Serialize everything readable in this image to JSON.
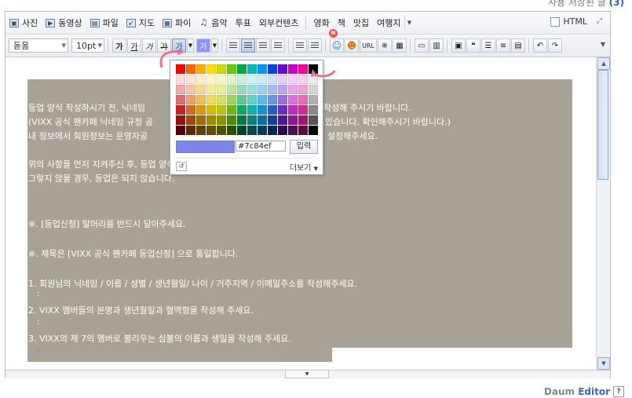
{
  "top": {
    "label": "사용 저장된 글",
    "count": "(3)"
  },
  "toolbar1": {
    "items": [
      {
        "label": "사진",
        "icon": "photo-icon"
      },
      {
        "label": "동영상",
        "icon": "video-icon"
      },
      {
        "label": "파일",
        "icon": "file-icon"
      },
      {
        "label": "지도",
        "icon": "map-icon"
      },
      {
        "label": "파이",
        "icon": "chart-icon"
      },
      {
        "label": "음악",
        "icon": "music-icon"
      },
      {
        "label": "투표",
        "icon": ""
      },
      {
        "label": "외부컨텐츠",
        "icon": ""
      }
    ],
    "tags": [
      "영화",
      "책",
      "맛집",
      "여행지"
    ],
    "html_label": "HTML"
  },
  "toolbar2": {
    "font": "돋움",
    "size": "10pt",
    "style_buttons": [
      "가",
      "가",
      "가",
      "가"
    ],
    "color_button": "가",
    "bg_button": "가"
  },
  "content": {
    "lines": [
      "등업 양식 작성하시기 전, 닉네임",
      "작성해 주시기 바랍니다.",
      "(VIXX 공식 팬카페 닉네임 규정 공",
      "있습니다. 확인해주시기 바랍니다.)",
      "내 정보에서 회원정보는 운영자공",
      "설정해주세요.",
      "위의 사항을 먼저 지켜주신 후, 등업 양식을 작성해주시기 바랍니다.",
      "그렇지 않을 경우, 등업은 되지 않습니다.",
      "※. [등업신청] 말머리를 반드시 달아주세요.",
      "※.  제목은 [VIXX 공식 팬카페 등업신청] 으로 통일합니다.",
      "1. 회원님의 닉네임 / 이름 / 성별 / 생년월일/ 나이 / 거주지역 / 이메일주소를 작성해주세요.",
      ":",
      "2. VIXX 멤버들의 본명과 생년월일과 혈액형을 작성해 주세요.",
      ":",
      "3. VIXX의 제 7의 멤버로 불리우는 심볼의 이름과 생일을 작성해 주세요.",
      ":"
    ],
    "heading_fragment": "닉"
  },
  "palette": {
    "hex_value": "#7c84ef",
    "apply_label": "입력",
    "more_label": "더보기",
    "preview_color": "#7c84ef",
    "rows": [
      [
        "#ff0000",
        "#ff6600",
        "#ffaa00",
        "#ffdd00",
        "#ccdd00",
        "#66cc00",
        "#00aa44",
        "#00bbbb",
        "#0099ee",
        "#0044ee",
        "#6600dd",
        "#cc00cc",
        "#ff0099",
        "#000000"
      ],
      [
        "#ffd9d9",
        "#ffe5d4",
        "#ffefcc",
        "#fff7cc",
        "#f6f8cc",
        "#e0f4cc",
        "#ccefdd",
        "#ccf2f2",
        "#cceafb",
        "#d0defb",
        "#e0d0f6",
        "#f6d0f6",
        "#ffd0ea",
        "#ececec"
      ],
      [
        "#f2aaaa",
        "#f5c5a8",
        "#f5d99a",
        "#f5ec99",
        "#e6ee99",
        "#c2e699",
        "#99dcbb",
        "#99e2e2",
        "#99d2f2",
        "#a4bdf2",
        "#c2a4ec",
        "#eaa4ea",
        "#f2a4d0",
        "#d4d4d4"
      ],
      [
        "#e56b6b",
        "#eba070",
        "#ebbf5f",
        "#ebdc5e",
        "#d3df5e",
        "#a0d45e",
        "#5ec894",
        "#5ed0d0",
        "#5eb8e8",
        "#6e96e6",
        "#9a70df",
        "#db6edb",
        "#e66eb4",
        "#b0b0b0"
      ],
      [
        "#cc2222",
        "#d46a22",
        "#d49a11",
        "#d4bd11",
        "#b8c611",
        "#70b811",
        "#11a85f",
        "#11b0b0",
        "#1194d4",
        "#2260d2",
        "#6a2bc8",
        "#c22bc2",
        "#d42b8c",
        "#8a8a8a"
      ],
      [
        "#991111",
        "#a04a11",
        "#a07000",
        "#a08c00",
        "#88960a",
        "#4e8a0a",
        "#0a7a44",
        "#0a8282",
        "#0a6ea0",
        "#163f9c",
        "#4a1894",
        "#901890",
        "#a0186a",
        "#555555"
      ],
      [
        "#550000",
        "#5e2800",
        "#5e4000",
        "#5e5000",
        "#4e5600",
        "#2b5000",
        "#004426",
        "#004a4a",
        "#003e5e",
        "#0a2258",
        "#2a0a54",
        "#520a52",
        "#5c0a3c",
        "#000000"
      ]
    ]
  }
}
